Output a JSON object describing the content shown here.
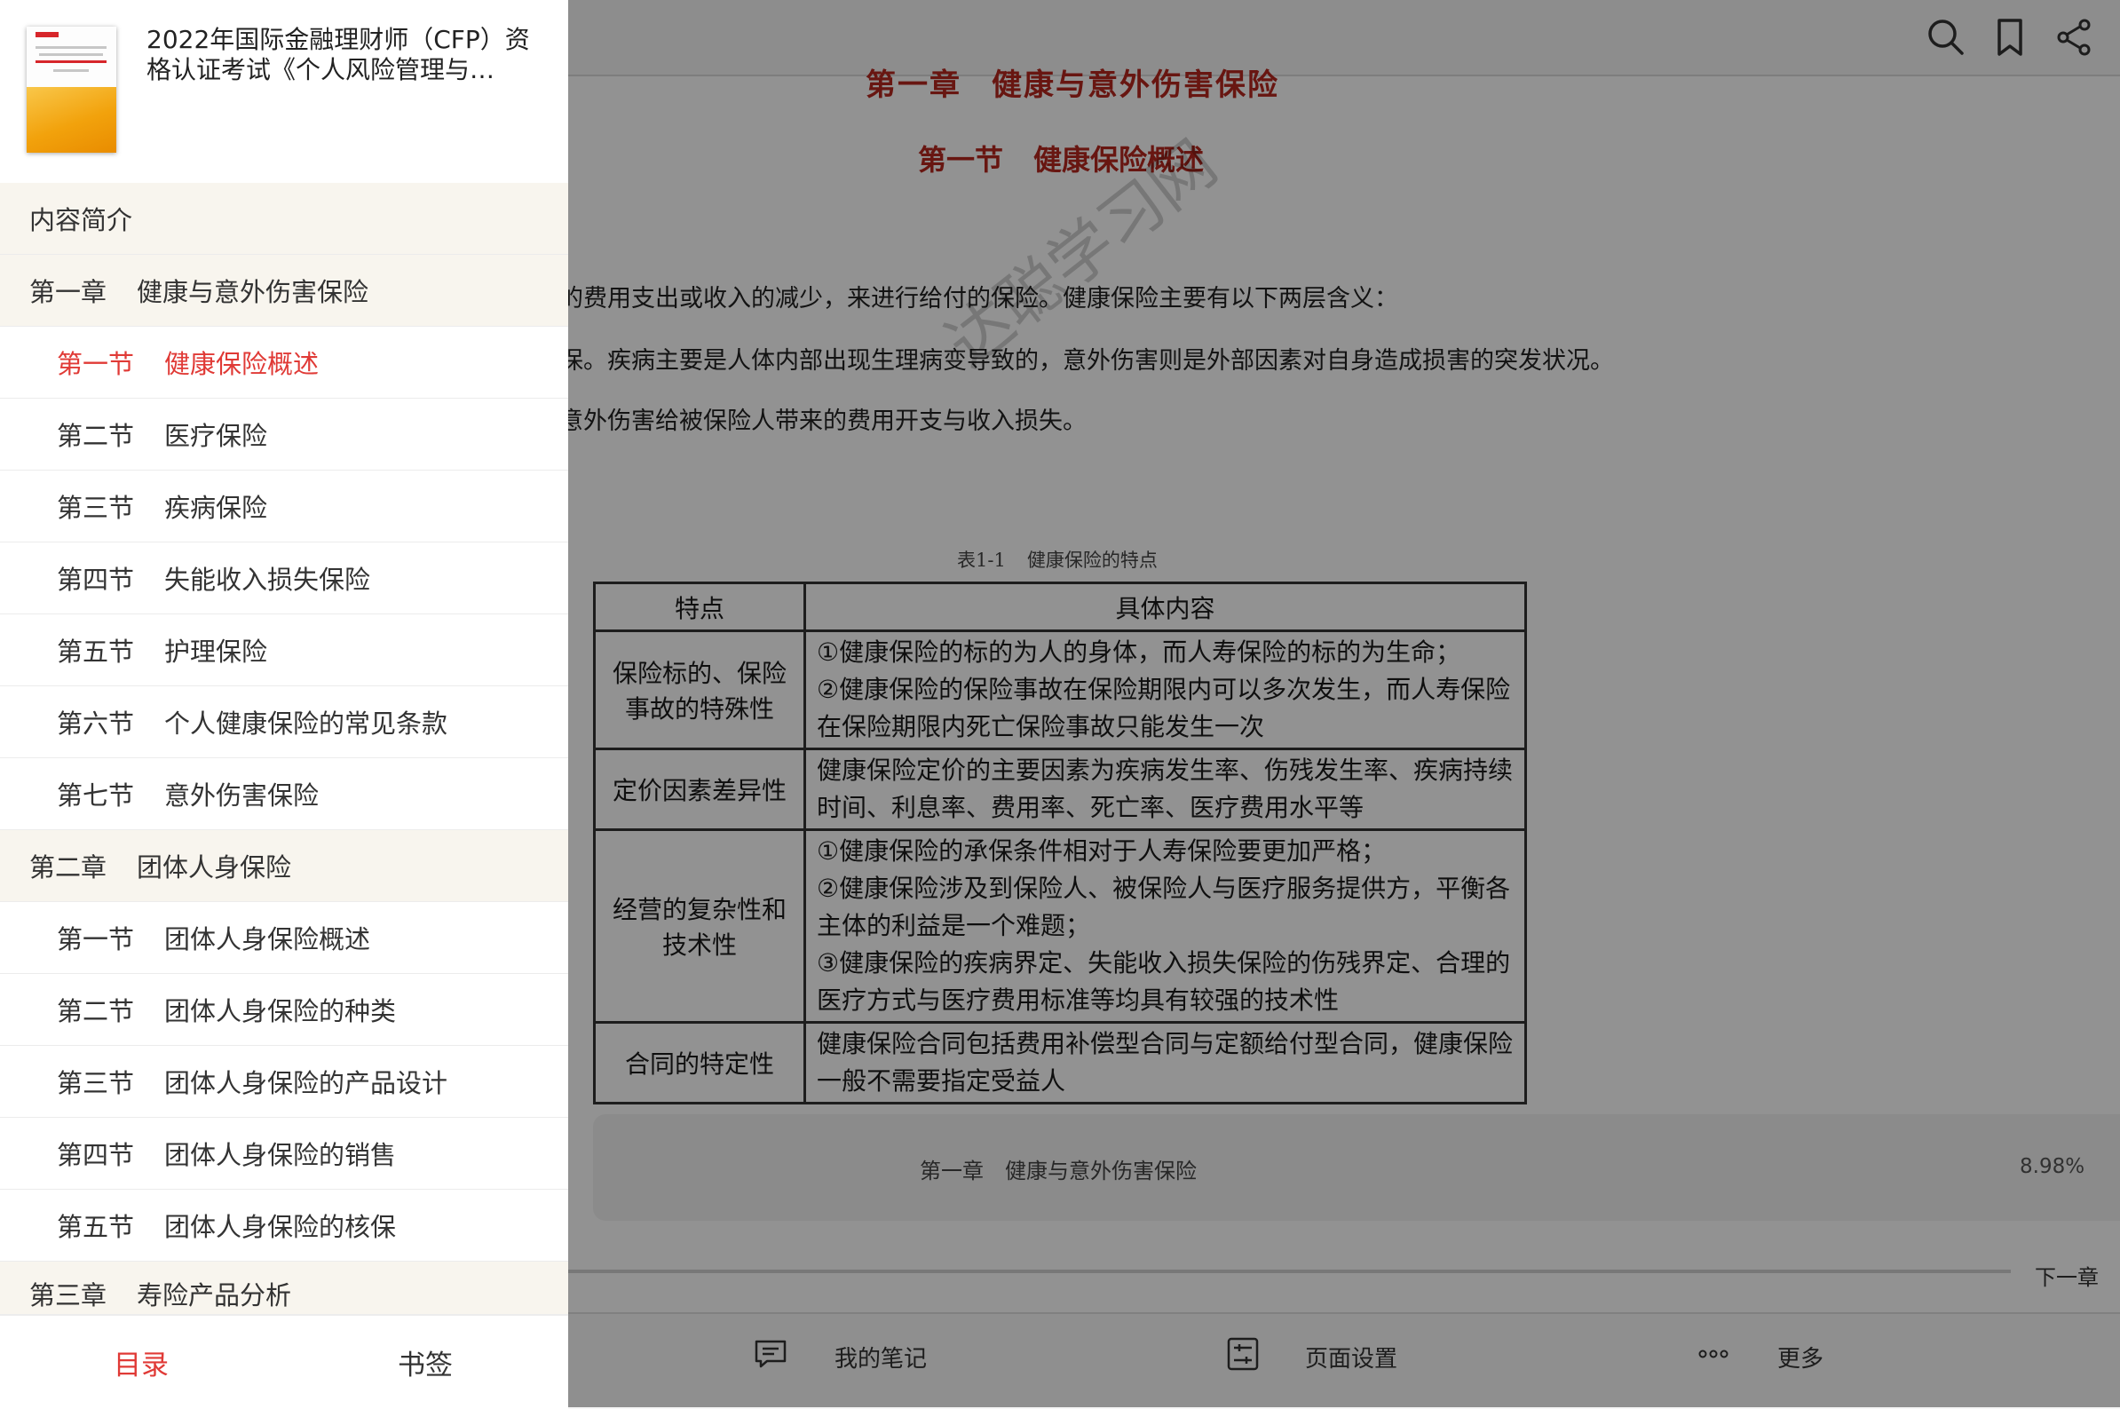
{
  "reader": {
    "chapter_heading": {
      "num": "第一章",
      "title": "健康与意外伤害保险"
    },
    "section_heading": {
      "num": "第一节",
      "title": "健康保险概述"
    },
    "paragraphs": [
      "的费用支出或收入的减少，来进行给付的保险。健康保险主要有以下两层含义：",
      "保。疾病主要是人体内部出现生理病变导致的，意外伤害则是外部因素对自身造成损害的突发状况。",
      "意外伤害给被保险人带来的费用开支与收入损失。"
    ],
    "watermark": "达聪学习网",
    "table_caption": {
      "num": "表1-1",
      "title": "健康保险的特点"
    },
    "table": {
      "headers": [
        "特点",
        "具体内容"
      ],
      "rows": [
        {
          "key": "保险标的、保险事故的特殊性",
          "lines": [
            "①健康保险的标的为人的身体，而人寿保险的标的为生命；",
            "②健康保险的保险事故在保险期限内可以多次发生，而人寿保险在保险期限内死亡保险事故只能发生一次"
          ]
        },
        {
          "key": "定价因素差异性",
          "lines": [
            "健康保险定价的主要因素为疾病发生率、伤残发生率、疾病持续时间、利息率、费用率、死亡率、医疗费用水平等"
          ]
        },
        {
          "key": "经营的复杂性和技术性",
          "lines": [
            "①健康保险的承保条件相对于人寿保险要更加严格；",
            "②健康保险涉及到保险人、被保险人与医疗服务提供方，平衡各主体的利益是一个难题；",
            "③健康保险的疾病界定、失能收入损失保险的伤残界定、合理的医疗方式与医疗费用标准等均具有较强的技术性"
          ]
        },
        {
          "key": "合同的特定性",
          "lines": [
            "健康保险合同包括费用补偿型合同与定额给付型合同，健康保险一般不需要指定受益人"
          ]
        }
      ]
    },
    "footer": {
      "chapter_num": "第一章",
      "chapter_title": "健康与意外伤害保险",
      "progress": "8.98%"
    },
    "next_chapter": "下一章",
    "bottom_bar": {
      "notes": "我的笔记",
      "page_settings": "页面设置",
      "more": "更多"
    }
  },
  "drawer": {
    "book_title": "2022年国际金融理财师（CFP）资格认证考试《个人风险管理与…",
    "toc": [
      {
        "level": "intro",
        "num": "内容简介",
        "title": ""
      },
      {
        "level": "chap",
        "num": "第一章",
        "title": "健康与意外伤害保险"
      },
      {
        "level": "sec",
        "num": "第一节",
        "title": "健康保险概述",
        "active": true
      },
      {
        "level": "sec",
        "num": "第二节",
        "title": "医疗保险"
      },
      {
        "level": "sec",
        "num": "第三节",
        "title": "疾病保险"
      },
      {
        "level": "sec",
        "num": "第四节",
        "title": "失能收入损失保险"
      },
      {
        "level": "sec",
        "num": "第五节",
        "title": "护理保险"
      },
      {
        "level": "sec",
        "num": "第六节",
        "title": "个人健康保险的常见条款"
      },
      {
        "level": "sec",
        "num": "第七节",
        "title": "意外伤害保险"
      },
      {
        "level": "chap",
        "num": "第二章",
        "title": "团体人身保险"
      },
      {
        "level": "sec",
        "num": "第一节",
        "title": "团体人身保险概述"
      },
      {
        "level": "sec",
        "num": "第二节",
        "title": "团体人身保险的种类"
      },
      {
        "level": "sec",
        "num": "第三节",
        "title": "团体人身保险的产品设计"
      },
      {
        "level": "sec",
        "num": "第四节",
        "title": "团体人身保险的销售"
      },
      {
        "level": "sec",
        "num": "第五节",
        "title": "团体人身保险的核保"
      },
      {
        "level": "chap",
        "num": "第三章",
        "title": "寿险产品分析"
      }
    ],
    "tabs": {
      "toc": "目录",
      "bookmarks": "书签"
    }
  },
  "colors": {
    "accent_red": "#e03a36",
    "heading_red": "#b3261e",
    "chapter_row_bg": "#f8f5ee"
  },
  "icons": [
    "search-icon",
    "bookmark-icon",
    "share-icon",
    "notes-icon",
    "settings-icon",
    "more-icon"
  ]
}
